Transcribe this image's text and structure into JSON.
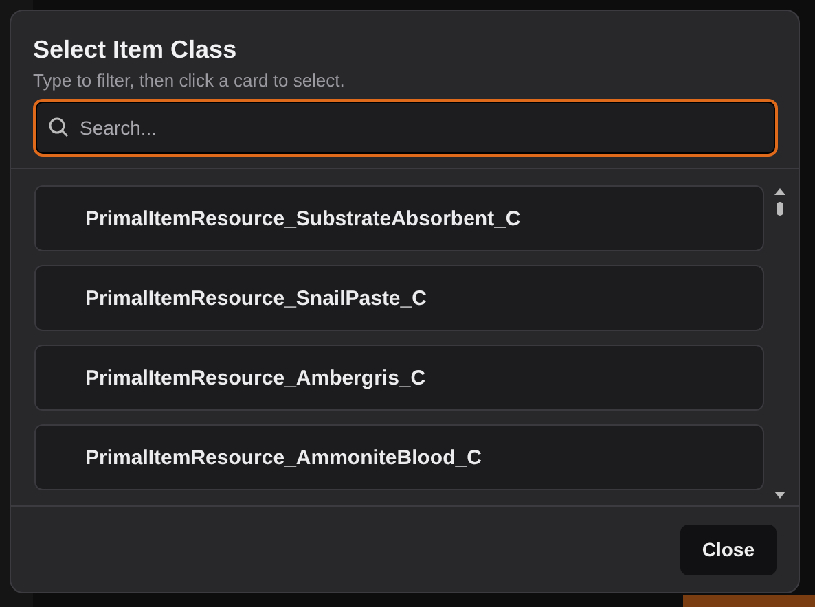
{
  "dialog": {
    "title": "Select Item Class",
    "subtitle": "Type to filter, then click a card to select.",
    "search": {
      "placeholder": "Search...",
      "focused": true
    },
    "items": [
      {
        "label": "PrimalItemResource_SubstrateAbsorbent_C"
      },
      {
        "label": "PrimalItemResource_SnailPaste_C"
      },
      {
        "label": "PrimalItemResource_Ambergris_C"
      },
      {
        "label": "PrimalItemResource_AmmoniteBlood_C"
      }
    ],
    "close_button": "Close"
  }
}
